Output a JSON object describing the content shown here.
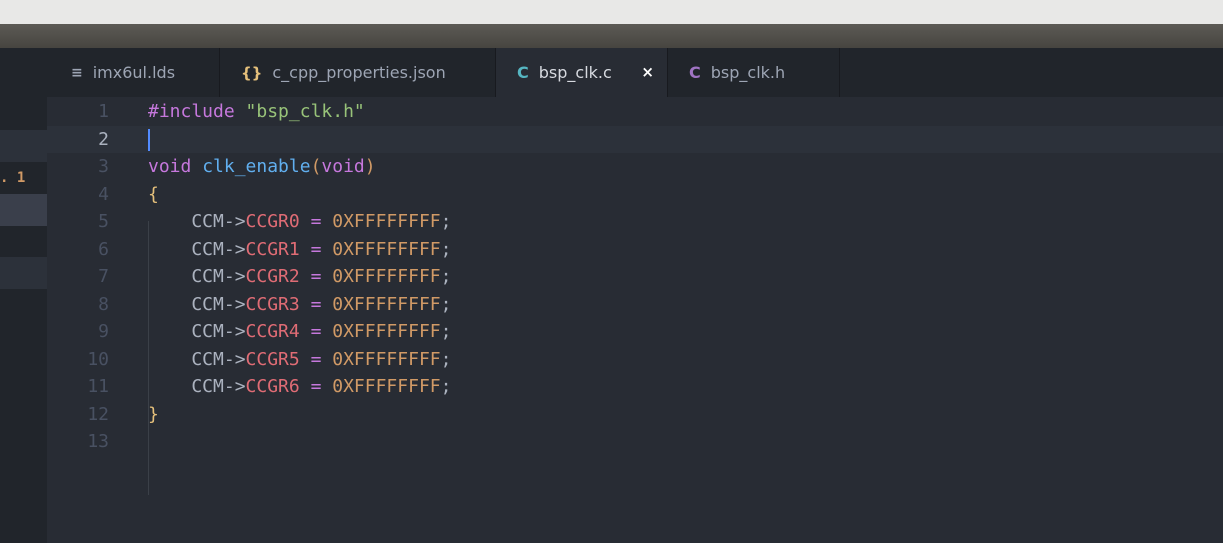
{
  "tabs": [
    {
      "icon": "≡",
      "icon_name": "text-file-icon",
      "icon_color": "#9da5b4",
      "label": "imx6ul.lds"
    },
    {
      "icon": "{}",
      "icon_name": "json-file-icon",
      "icon_color": "#e5c07b",
      "label": "c_cpp_properties.json"
    },
    {
      "icon": "C",
      "icon_name": "c-source-file-icon",
      "icon_color": "#56b6c2",
      "label": "bsp_clk.c",
      "active": true,
      "close": "×"
    },
    {
      "icon": "C",
      "icon_name": "c-header-file-icon",
      "icon_color": "#a074c4",
      "label": "bsp_clk.h"
    }
  ],
  "sidebar": {
    "badge": ". 1"
  },
  "editor": {
    "line_numbers": [
      "1",
      "2",
      "3",
      "4",
      "5",
      "6",
      "7",
      "8",
      "9",
      "10",
      "11",
      "12",
      "13"
    ],
    "cursor_line": 2,
    "lines": [
      [
        {
          "t": "#include ",
          "c": "kw"
        },
        {
          "t": "\"bsp_clk.h\"",
          "c": "str"
        }
      ],
      [],
      [
        {
          "t": "void ",
          "c": "kw"
        },
        {
          "t": "clk_enable",
          "c": "fn"
        },
        {
          "t": "(",
          "c": "paren"
        },
        {
          "t": "void",
          "c": "kw"
        },
        {
          "t": ")",
          "c": "paren"
        }
      ],
      [
        {
          "t": "{",
          "c": "brace"
        }
      ],
      [
        {
          "t": "    CCM->",
          "c": "plain"
        },
        {
          "t": "CCGR0",
          "c": "prop"
        },
        {
          "t": " = ",
          "c": "op"
        },
        {
          "t": "0XFFFFFFFF",
          "c": "num"
        },
        {
          "t": ";",
          "c": "plain"
        }
      ],
      [
        {
          "t": "    CCM->",
          "c": "plain"
        },
        {
          "t": "CCGR1",
          "c": "prop"
        },
        {
          "t": " = ",
          "c": "op"
        },
        {
          "t": "0XFFFFFFFF",
          "c": "num"
        },
        {
          "t": ";",
          "c": "plain"
        }
      ],
      [
        {
          "t": "    CCM->",
          "c": "plain"
        },
        {
          "t": "CCGR2",
          "c": "prop"
        },
        {
          "t": " = ",
          "c": "op"
        },
        {
          "t": "0XFFFFFFFF",
          "c": "num"
        },
        {
          "t": ";",
          "c": "plain"
        }
      ],
      [
        {
          "t": "    CCM->",
          "c": "plain"
        },
        {
          "t": "CCGR3",
          "c": "prop"
        },
        {
          "t": " = ",
          "c": "op"
        },
        {
          "t": "0XFFFFFFFF",
          "c": "num"
        },
        {
          "t": ";",
          "c": "plain"
        }
      ],
      [
        {
          "t": "    CCM->",
          "c": "plain"
        },
        {
          "t": "CCGR4",
          "c": "prop"
        },
        {
          "t": " = ",
          "c": "op"
        },
        {
          "t": "0XFFFFFFFF",
          "c": "num"
        },
        {
          "t": ";",
          "c": "plain"
        }
      ],
      [
        {
          "t": "    CCM->",
          "c": "plain"
        },
        {
          "t": "CCGR5",
          "c": "prop"
        },
        {
          "t": " = ",
          "c": "op"
        },
        {
          "t": "0XFFFFFFFF",
          "c": "num"
        },
        {
          "t": ";",
          "c": "plain"
        }
      ],
      [
        {
          "t": "    CCM->",
          "c": "plain"
        },
        {
          "t": "CCGR6",
          "c": "prop"
        },
        {
          "t": " = ",
          "c": "op"
        },
        {
          "t": "0XFFFFFFFF",
          "c": "num"
        },
        {
          "t": ";",
          "c": "plain"
        }
      ],
      [
        {
          "t": "}",
          "c": "brace"
        }
      ],
      []
    ]
  }
}
